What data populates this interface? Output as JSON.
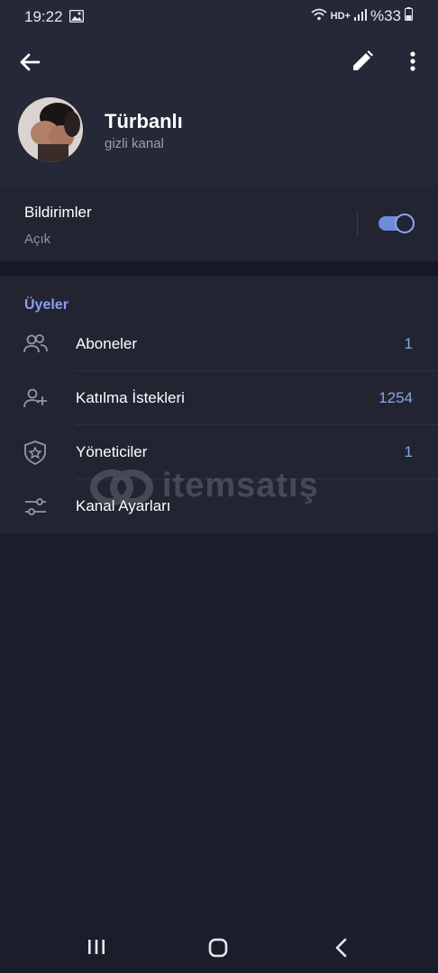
{
  "status_bar": {
    "time": "19:22",
    "network": "HD+",
    "battery": "%33"
  },
  "header": {
    "channel_name": "Türbanlı",
    "channel_type": "gizli kanal",
    "icons": [
      "back-arrow-icon",
      "edit-pencil-icon",
      "more-vert-icon"
    ]
  },
  "notifications": {
    "title": "Bildirimler",
    "status": "Açık",
    "enabled": true
  },
  "members": {
    "section_title": "Üyeler",
    "rows": [
      {
        "label": "Aboneler",
        "value": "1",
        "icon": "people-icon"
      },
      {
        "label": "Katılma İstekleri",
        "value": "1254",
        "icon": "add-person-icon"
      },
      {
        "label": "Yöneticiler",
        "value": "1",
        "icon": "shield-star-icon"
      },
      {
        "label": "Kanal Ayarları",
        "value": "",
        "icon": "settings-sliders-icon"
      }
    ]
  },
  "watermark": {
    "text": "itemsatış"
  },
  "colors": {
    "background": "#1c1d2a",
    "header_bg": "#252836",
    "card_bg": "#222432",
    "accent": "#86a2ee",
    "toggle_track": "#6f8ad6"
  }
}
